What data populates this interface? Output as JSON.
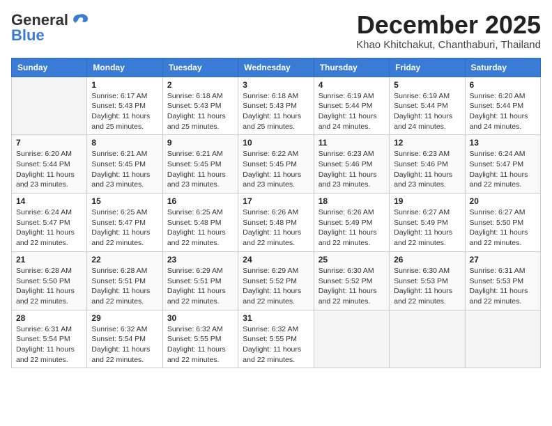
{
  "header": {
    "logo_line1": "General",
    "logo_line2": "Blue",
    "month": "December 2025",
    "location": "Khao Khitchakut, Chanthaburi, Thailand"
  },
  "weekdays": [
    "Sunday",
    "Monday",
    "Tuesday",
    "Wednesday",
    "Thursday",
    "Friday",
    "Saturday"
  ],
  "weeks": [
    [
      {
        "day": "",
        "sunrise": "",
        "sunset": "",
        "daylight": ""
      },
      {
        "day": "1",
        "sunrise": "Sunrise: 6:17 AM",
        "sunset": "Sunset: 5:43 PM",
        "daylight": "Daylight: 11 hours and 25 minutes."
      },
      {
        "day": "2",
        "sunrise": "Sunrise: 6:18 AM",
        "sunset": "Sunset: 5:43 PM",
        "daylight": "Daylight: 11 hours and 25 minutes."
      },
      {
        "day": "3",
        "sunrise": "Sunrise: 6:18 AM",
        "sunset": "Sunset: 5:43 PM",
        "daylight": "Daylight: 11 hours and 25 minutes."
      },
      {
        "day": "4",
        "sunrise": "Sunrise: 6:19 AM",
        "sunset": "Sunset: 5:44 PM",
        "daylight": "Daylight: 11 hours and 24 minutes."
      },
      {
        "day": "5",
        "sunrise": "Sunrise: 6:19 AM",
        "sunset": "Sunset: 5:44 PM",
        "daylight": "Daylight: 11 hours and 24 minutes."
      },
      {
        "day": "6",
        "sunrise": "Sunrise: 6:20 AM",
        "sunset": "Sunset: 5:44 PM",
        "daylight": "Daylight: 11 hours and 24 minutes."
      }
    ],
    [
      {
        "day": "7",
        "sunrise": "Sunrise: 6:20 AM",
        "sunset": "Sunset: 5:44 PM",
        "daylight": "Daylight: 11 hours and 23 minutes."
      },
      {
        "day": "8",
        "sunrise": "Sunrise: 6:21 AM",
        "sunset": "Sunset: 5:45 PM",
        "daylight": "Daylight: 11 hours and 23 minutes."
      },
      {
        "day": "9",
        "sunrise": "Sunrise: 6:21 AM",
        "sunset": "Sunset: 5:45 PM",
        "daylight": "Daylight: 11 hours and 23 minutes."
      },
      {
        "day": "10",
        "sunrise": "Sunrise: 6:22 AM",
        "sunset": "Sunset: 5:45 PM",
        "daylight": "Daylight: 11 hours and 23 minutes."
      },
      {
        "day": "11",
        "sunrise": "Sunrise: 6:23 AM",
        "sunset": "Sunset: 5:46 PM",
        "daylight": "Daylight: 11 hours and 23 minutes."
      },
      {
        "day": "12",
        "sunrise": "Sunrise: 6:23 AM",
        "sunset": "Sunset: 5:46 PM",
        "daylight": "Daylight: 11 hours and 23 minutes."
      },
      {
        "day": "13",
        "sunrise": "Sunrise: 6:24 AM",
        "sunset": "Sunset: 5:47 PM",
        "daylight": "Daylight: 11 hours and 22 minutes."
      }
    ],
    [
      {
        "day": "14",
        "sunrise": "Sunrise: 6:24 AM",
        "sunset": "Sunset: 5:47 PM",
        "daylight": "Daylight: 11 hours and 22 minutes."
      },
      {
        "day": "15",
        "sunrise": "Sunrise: 6:25 AM",
        "sunset": "Sunset: 5:47 PM",
        "daylight": "Daylight: 11 hours and 22 minutes."
      },
      {
        "day": "16",
        "sunrise": "Sunrise: 6:25 AM",
        "sunset": "Sunset: 5:48 PM",
        "daylight": "Daylight: 11 hours and 22 minutes."
      },
      {
        "day": "17",
        "sunrise": "Sunrise: 6:26 AM",
        "sunset": "Sunset: 5:48 PM",
        "daylight": "Daylight: 11 hours and 22 minutes."
      },
      {
        "day": "18",
        "sunrise": "Sunrise: 6:26 AM",
        "sunset": "Sunset: 5:49 PM",
        "daylight": "Daylight: 11 hours and 22 minutes."
      },
      {
        "day": "19",
        "sunrise": "Sunrise: 6:27 AM",
        "sunset": "Sunset: 5:49 PM",
        "daylight": "Daylight: 11 hours and 22 minutes."
      },
      {
        "day": "20",
        "sunrise": "Sunrise: 6:27 AM",
        "sunset": "Sunset: 5:50 PM",
        "daylight": "Daylight: 11 hours and 22 minutes."
      }
    ],
    [
      {
        "day": "21",
        "sunrise": "Sunrise: 6:28 AM",
        "sunset": "Sunset: 5:50 PM",
        "daylight": "Daylight: 11 hours and 22 minutes."
      },
      {
        "day": "22",
        "sunrise": "Sunrise: 6:28 AM",
        "sunset": "Sunset: 5:51 PM",
        "daylight": "Daylight: 11 hours and 22 minutes."
      },
      {
        "day": "23",
        "sunrise": "Sunrise: 6:29 AM",
        "sunset": "Sunset: 5:51 PM",
        "daylight": "Daylight: 11 hours and 22 minutes."
      },
      {
        "day": "24",
        "sunrise": "Sunrise: 6:29 AM",
        "sunset": "Sunset: 5:52 PM",
        "daylight": "Daylight: 11 hours and 22 minutes."
      },
      {
        "day": "25",
        "sunrise": "Sunrise: 6:30 AM",
        "sunset": "Sunset: 5:52 PM",
        "daylight": "Daylight: 11 hours and 22 minutes."
      },
      {
        "day": "26",
        "sunrise": "Sunrise: 6:30 AM",
        "sunset": "Sunset: 5:53 PM",
        "daylight": "Daylight: 11 hours and 22 minutes."
      },
      {
        "day": "27",
        "sunrise": "Sunrise: 6:31 AM",
        "sunset": "Sunset: 5:53 PM",
        "daylight": "Daylight: 11 hours and 22 minutes."
      }
    ],
    [
      {
        "day": "28",
        "sunrise": "Sunrise: 6:31 AM",
        "sunset": "Sunset: 5:54 PM",
        "daylight": "Daylight: 11 hours and 22 minutes."
      },
      {
        "day": "29",
        "sunrise": "Sunrise: 6:32 AM",
        "sunset": "Sunset: 5:54 PM",
        "daylight": "Daylight: 11 hours and 22 minutes."
      },
      {
        "day": "30",
        "sunrise": "Sunrise: 6:32 AM",
        "sunset": "Sunset: 5:55 PM",
        "daylight": "Daylight: 11 hours and 22 minutes."
      },
      {
        "day": "31",
        "sunrise": "Sunrise: 6:32 AM",
        "sunset": "Sunset: 5:55 PM",
        "daylight": "Daylight: 11 hours and 22 minutes."
      },
      {
        "day": "",
        "sunrise": "",
        "sunset": "",
        "daylight": ""
      },
      {
        "day": "",
        "sunrise": "",
        "sunset": "",
        "daylight": ""
      },
      {
        "day": "",
        "sunrise": "",
        "sunset": "",
        "daylight": ""
      }
    ]
  ]
}
